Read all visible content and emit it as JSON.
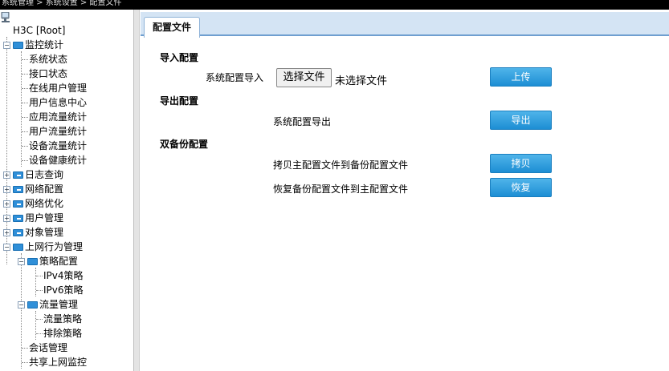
{
  "breadcrumb": "系统管理 > 系统设置 > 配置文件",
  "tree": {
    "root": "H3C [Root]",
    "monitor": {
      "label": "监控统计",
      "items": [
        "系统状态",
        "接口状态",
        "在线用户管理",
        "用户信息中心",
        "应用流量统计",
        "用户流量统计",
        "设备流量统计",
        "设备健康统计"
      ]
    },
    "log_query": "日志查询",
    "network_config": "网络配置",
    "network_opt": "网络优化",
    "user_mgmt": "用户管理",
    "object_mgmt": "对象管理",
    "internet_behavior": {
      "label": "上网行为管理",
      "policy_config": {
        "label": "策略配置",
        "items": [
          "IPv4策略",
          "IPv6策略"
        ]
      },
      "traffic_mgmt": {
        "label": "流量管理",
        "items": [
          "流量策略",
          "排除策略"
        ]
      },
      "session_mgmt": "会话管理",
      "shared_monitor": "共享上网监控"
    }
  },
  "tab": {
    "label": "配置文件"
  },
  "import": {
    "title": "导入配置",
    "row_label": "系统配置导入",
    "choose_file": "选择文件",
    "file_status": "未选择文件",
    "upload": "上传"
  },
  "export": {
    "title": "导出配置",
    "row_label": "系统配置导出",
    "button": "导出"
  },
  "dual": {
    "title": "双备份配置",
    "copy_label": "拷贝主配置文件到备份配置文件",
    "copy_button": "拷贝",
    "restore_label": "恢复备份配置文件到主配置文件",
    "restore_button": "恢复"
  },
  "colors": {
    "accent_button": "#1d8ed4",
    "tabbar": "#d4e4f4",
    "folder": "#2f8fd8"
  }
}
